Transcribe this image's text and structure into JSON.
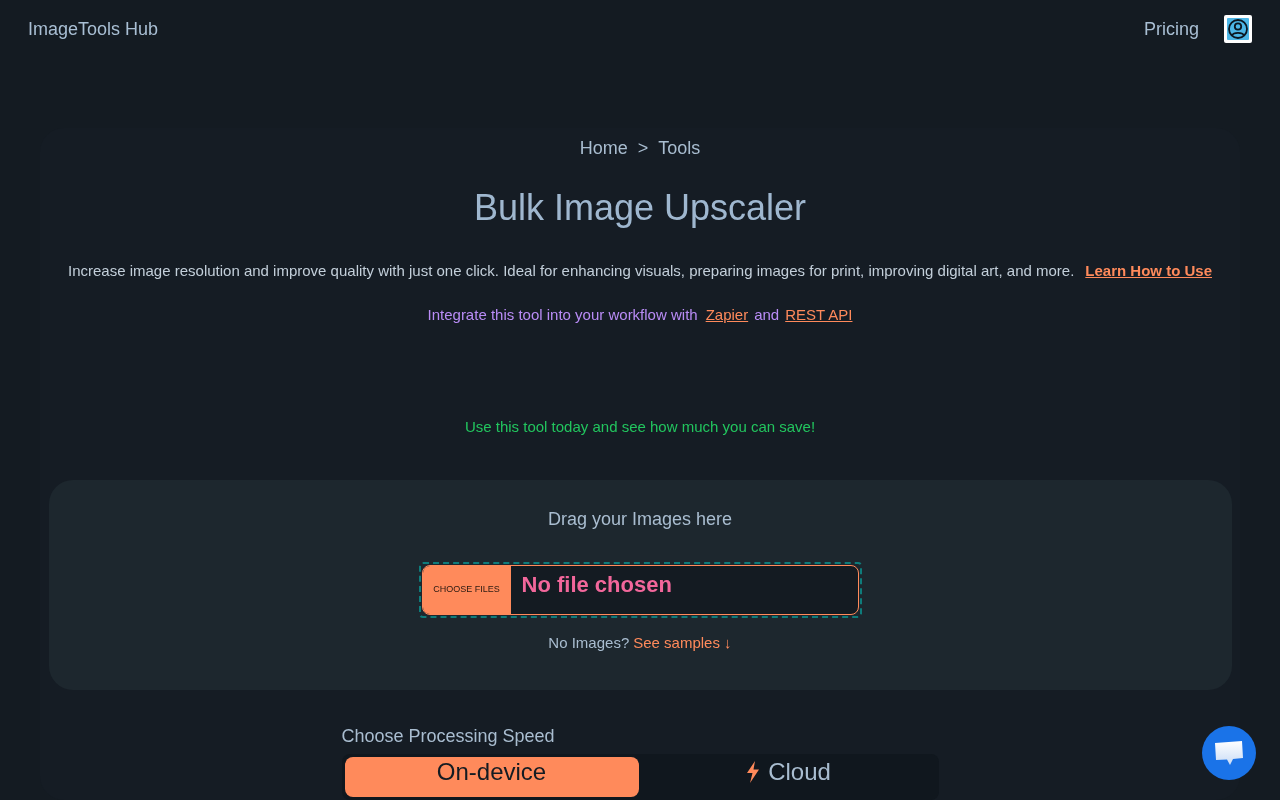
{
  "header": {
    "brand": "ImageTools Hub",
    "nav": [
      {
        "label": "Pricing"
      }
    ]
  },
  "breadcrumb": {
    "items": [
      {
        "label": "Home"
      },
      {
        "label": "Tools"
      }
    ],
    "separator": ">"
  },
  "title": "Bulk Image Upscaler",
  "description": {
    "text": "Increase image resolution and improve quality with just one click. Ideal for enhancing visuals, preparing images for print, improving digital art, and more.",
    "link": "Learn How to Use"
  },
  "integration": {
    "prefix": "Integrate this tool into your workflow with",
    "links": [
      "Zapier",
      "REST API"
    ],
    "conjunction": "and"
  },
  "promo": "Use this tool today and see how much you can save!",
  "upload": {
    "heading": "Drag your Images here",
    "button": "CHOOSE FILES",
    "status": "No file chosen",
    "samples_prompt": "No Images?",
    "samples_link": "See samples ↓"
  },
  "speed": {
    "label": "Choose Processing Speed",
    "options": [
      {
        "label": "On-device",
        "kind": "local",
        "selected": true
      },
      {
        "label": "Cloud",
        "kind": "cloud",
        "selected": false
      }
    ]
  }
}
